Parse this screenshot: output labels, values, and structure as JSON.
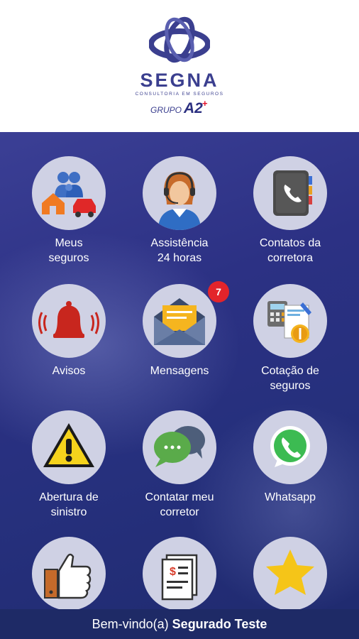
{
  "brand": {
    "name": "SEGNA",
    "tagline": "CONSULTORIA EM SEGUROS",
    "group_prefix": "GRUPO",
    "group_mark": "A2",
    "group_plus": "+"
  },
  "colors": {
    "brand_blue": "#3b3f8f",
    "accent_red": "#e3242b",
    "background_dark": "#2c3184",
    "footer_bg": "#1e2a66",
    "icon_circle": "#cfd1e4"
  },
  "menu": [
    {
      "label": "Meus\nseguros",
      "icon": "family-house-car-icon"
    },
    {
      "label": "Assistência\n24 horas",
      "icon": "headset-attendant-icon"
    },
    {
      "label": "Contatos da\ncorretora",
      "icon": "phone-book-icon"
    },
    {
      "label": "Avisos",
      "icon": "alarm-bell-icon"
    },
    {
      "label": "Mensagens",
      "icon": "envelope-icon",
      "badge": "7"
    },
    {
      "label": "Cotação de\nseguros",
      "icon": "calculator-money-icon"
    },
    {
      "label": "Abertura de\nsinistro",
      "icon": "warning-triangle-icon"
    },
    {
      "label": "Contatar meu\ncorretor",
      "icon": "chat-bubbles-icon"
    },
    {
      "label": "Whatsapp",
      "icon": "whatsapp-icon"
    },
    {
      "label": "",
      "icon": "thumbs-up-icon"
    },
    {
      "label": "",
      "icon": "invoice-document-icon"
    },
    {
      "label": "",
      "icon": "star-icon"
    }
  ],
  "footer": {
    "welcome": "Bem-vindo(a)",
    "user_name": "Segurado Teste"
  }
}
